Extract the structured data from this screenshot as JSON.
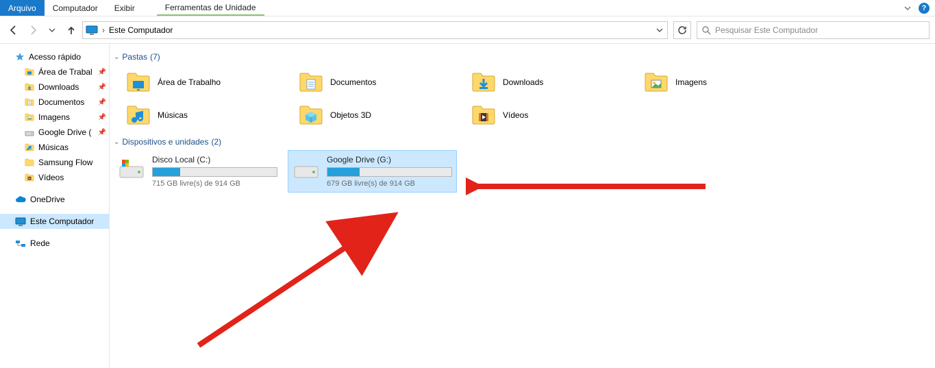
{
  "menu": {
    "file": "Arquivo",
    "computer": "Computador",
    "view": "Exibir",
    "drive_tools": "Ferramentas de Unidade"
  },
  "nav": {
    "breadcrumb_root": "Este Computador",
    "search_placeholder": "Pesquisar Este Computador"
  },
  "sidebar": {
    "quick": "Acesso rápido",
    "quick_items": [
      {
        "label": "Área de Trabal",
        "icon": "desktop",
        "pin": true
      },
      {
        "label": "Downloads",
        "icon": "downloads",
        "pin": true
      },
      {
        "label": "Documentos",
        "icon": "documents",
        "pin": true
      },
      {
        "label": "Imagens",
        "icon": "pictures",
        "pin": true
      },
      {
        "label": "Google Drive (",
        "icon": "gdrive",
        "pin": true
      },
      {
        "label": "Músicas",
        "icon": "music",
        "pin": false
      },
      {
        "label": "Samsung Flow",
        "icon": "folder",
        "pin": false
      },
      {
        "label": "Vídeos",
        "icon": "videos",
        "pin": false
      }
    ],
    "onedrive": "OneDrive",
    "this_pc": "Este Computador",
    "network": "Rede"
  },
  "sections": {
    "folders_label": "Pastas",
    "folders_count": "(7)",
    "drives_label": "Dispositivos e unidades",
    "drives_count": "(2)"
  },
  "folders": [
    {
      "label": "Área de Trabalho",
      "icon": "desktop"
    },
    {
      "label": "Documentos",
      "icon": "documents"
    },
    {
      "label": "Downloads",
      "icon": "downloads"
    },
    {
      "label": "Imagens",
      "icon": "pictures"
    },
    {
      "label": "Músicas",
      "icon": "music"
    },
    {
      "label": "Objetos 3D",
      "icon": "objects3d"
    },
    {
      "label": "Vídeos",
      "icon": "videos"
    }
  ],
  "drives": [
    {
      "name": "Disco Local (C:)",
      "sub": "715 GB livre(s) de 914 GB",
      "fill": 22,
      "icon": "localdisk",
      "selected": false
    },
    {
      "name": "Google Drive (G:)",
      "sub": "679 GB livre(s) de 914 GB",
      "fill": 26,
      "icon": "drive",
      "selected": true
    }
  ]
}
